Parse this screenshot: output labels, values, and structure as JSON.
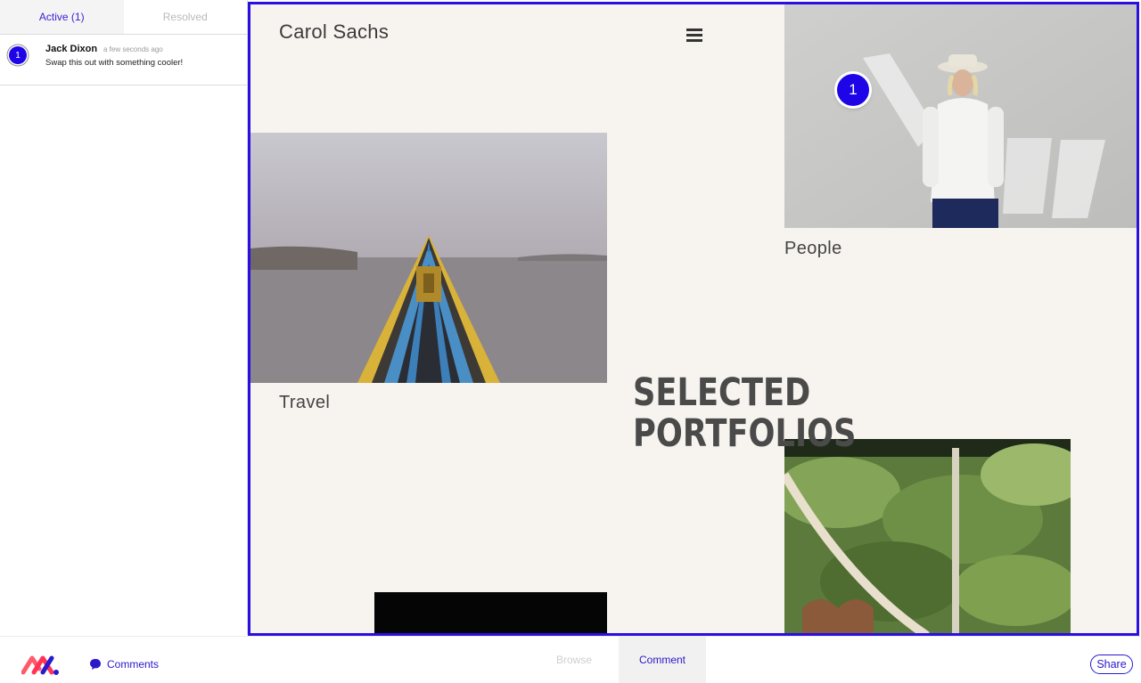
{
  "sidebar": {
    "tabs": [
      {
        "label": "Active (1)",
        "active": true
      },
      {
        "label": "Resolved",
        "active": false
      }
    ],
    "comments": [
      {
        "number": "1",
        "author": "Jack Dixon",
        "time": "a few seconds ago",
        "text": "Swap this out with something cooler!"
      }
    ]
  },
  "preview": {
    "site_title": "Carol Sachs",
    "heading_lines": [
      "SELECTED",
      "PORTFOLIOS"
    ],
    "portfolios": [
      {
        "caption": "People"
      },
      {
        "caption": "Travel"
      }
    ],
    "pin_number": "1"
  },
  "bottombar": {
    "comments_label": "Comments",
    "modes": [
      {
        "label": "Browse",
        "active": false
      },
      {
        "label": "Comment",
        "active": true
      }
    ],
    "share_label": "Share"
  },
  "colors": {
    "accent": "#2b0ee0",
    "pin": "#1e05e8",
    "page_background": "#f7f4ef"
  },
  "icons": [
    "hamburger-menu-icon",
    "chat-bubble-icon",
    "logo"
  ]
}
